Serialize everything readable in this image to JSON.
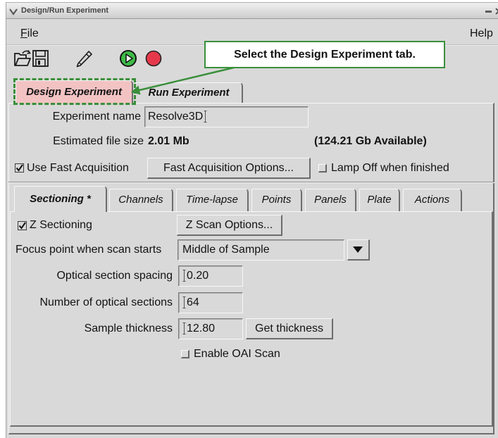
{
  "window": {
    "title": "Design/Run Experiment",
    "menu_icon": "chevron-down-icon",
    "controls": [
      "minimize-icon",
      "close-icon"
    ]
  },
  "menu": {
    "file": "File",
    "help": "Help"
  },
  "toolbar": {
    "icons": [
      "open-folder-icon",
      "save-icon",
      "edit-icon",
      "play-icon",
      "stop-icon"
    ]
  },
  "callout": {
    "text": "Select the Design Experiment tab."
  },
  "tabs": [
    {
      "label": "Design Experiment",
      "selected": true,
      "highlighted": true
    },
    {
      "label": "Run Experiment",
      "selected": false,
      "highlighted": false
    }
  ],
  "design": {
    "experiment_name": {
      "label": "Experiment name",
      "value": "Resolve3D"
    },
    "file_size": {
      "label": "Estimated file size",
      "value": "2.01 Mb",
      "available": "(124.21 Gb Available)"
    },
    "fast_acquisition": {
      "label": "Use Fast Acquisition",
      "checked": true
    },
    "fast_acquisition_options": {
      "label": "Fast Acquisition Options..."
    },
    "lamp_off": {
      "label": "Lamp Off when finished",
      "checked": false
    }
  },
  "sub_tabs": [
    {
      "label": "Sectioning *",
      "selected": true
    },
    {
      "label": "Channels",
      "selected": false
    },
    {
      "label": "Time-lapse",
      "selected": false
    },
    {
      "label": "Points",
      "selected": false
    },
    {
      "label": "Panels",
      "selected": false
    },
    {
      "label": "Plate",
      "selected": false
    },
    {
      "label": "Actions",
      "selected": false
    }
  ],
  "sectioning": {
    "z_sectioning": {
      "label": "Z Sectioning",
      "checked": true
    },
    "z_scan_options": {
      "label": "Z Scan Options..."
    },
    "focus_point": {
      "label": "Focus point when scan starts",
      "value": "Middle of Sample"
    },
    "section_spacing": {
      "label": "Optical section spacing",
      "value": "0.20"
    },
    "section_count": {
      "label": "Number of optical sections",
      "value": "64"
    },
    "sample_thickness": {
      "label": "Sample thickness",
      "value": "12.80"
    },
    "get_thickness": {
      "label": "Get thickness"
    },
    "oai_scan": {
      "label": "Enable OAI Scan",
      "checked": false
    }
  },
  "colors": {
    "window_bg": "#d9d9d9",
    "annotation_green": "#3a8f3a",
    "tab_highlight": "#f3c3c3",
    "play_green": "#3dbb47",
    "stop_red": "#e5394b"
  }
}
